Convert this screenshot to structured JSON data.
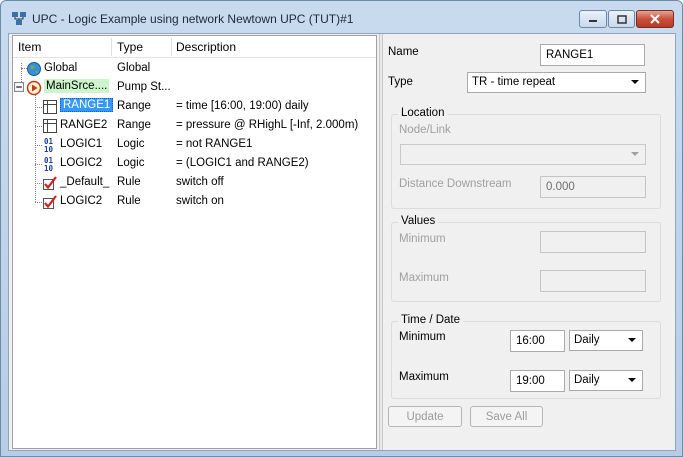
{
  "window": {
    "title": "UPC - Logic Example using network Newtown UPC (TUT)#1"
  },
  "tree": {
    "columns": [
      "Item",
      "Type",
      "Description"
    ],
    "rows": [
      {
        "item": "Global",
        "type": "Global",
        "description": "",
        "icon": "globe-icon"
      },
      {
        "item": "MainSrce....",
        "type": "Pump St...",
        "description": "",
        "icon": "pump-station-icon"
      },
      {
        "item": "RANGE1",
        "type": "Range",
        "description": "= time [16:00, 19:00) daily",
        "icon": "range-grid-icon"
      },
      {
        "item": "RANGE2",
        "type": "Range",
        "description": "= pressure @ RHighL [-Inf, 2.000m)",
        "icon": "range-grid-icon"
      },
      {
        "item": "LOGIC1",
        "type": "Logic",
        "description": "= not RANGE1",
        "icon": "binary-logic-icon"
      },
      {
        "item": "LOGIC2",
        "type": "Logic",
        "description": "= (LOGIC1 and RANGE2)",
        "icon": "binary-logic-icon"
      },
      {
        "item": "_Default_",
        "type": "Rule",
        "description": "switch off",
        "icon": "rule-check-icon"
      },
      {
        "item": "LOGIC2",
        "type": "Rule",
        "description": "switch on",
        "icon": "rule-check-icon"
      }
    ],
    "binary_glyph": "01\n10"
  },
  "form": {
    "name_label": "Name",
    "name_value": "RANGE1",
    "type_label": "Type",
    "type_value": "TR - time repeat",
    "location": {
      "title": "Location",
      "node_link_label": "Node/Link",
      "node_link_value": "",
      "distance_label": "Distance Downstream",
      "distance_value": "0.000"
    },
    "values": {
      "title": "Values",
      "minimum_label": "Minimum",
      "minimum_value": "",
      "maximum_label": "Maximum",
      "maximum_value": ""
    },
    "time_date": {
      "title": "Time / Date",
      "minimum_label": "Minimum",
      "minimum_time": "16:00",
      "minimum_period": "Daily",
      "maximum_label": "Maximum",
      "maximum_time": "19:00",
      "maximum_period": "Daily"
    },
    "update_label": "Update",
    "save_all_label": "Save All"
  }
}
